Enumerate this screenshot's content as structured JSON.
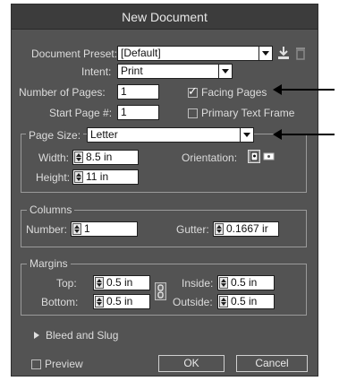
{
  "window": {
    "title": "New Document"
  },
  "document_preset": {
    "label": "Document Preset:",
    "value": "[Default]"
  },
  "intent": {
    "label": "Intent:",
    "value": "Print"
  },
  "pages": {
    "num_label": "Number of Pages:",
    "num_value": "1",
    "start_label": "Start Page #:",
    "start_value": "1"
  },
  "facing_pages": {
    "label": "Facing Pages",
    "checked": true
  },
  "primary_text_frame": {
    "label": "Primary Text Frame",
    "checked": false
  },
  "page_size": {
    "label": "Page Size:",
    "value": "Letter",
    "width_label": "Width:",
    "width_value": "8.5 in",
    "height_label": "Height:",
    "height_value": "11 in",
    "orientation_label": "Orientation:"
  },
  "columns": {
    "title": "Columns",
    "number_label": "Number:",
    "number_value": "1",
    "gutter_label": "Gutter:",
    "gutter_value": "0.1667 ir"
  },
  "margins": {
    "title": "Margins",
    "top_label": "Top:",
    "top_value": "0.5 in",
    "bottom_label": "Bottom:",
    "bottom_value": "0.5 in",
    "inside_label": "Inside:",
    "inside_value": "0.5 in",
    "outside_label": "Outside:",
    "outside_value": "0.5 in"
  },
  "bleed": {
    "label": "Bleed and Slug"
  },
  "preview": {
    "label": "Preview",
    "checked": false
  },
  "buttons": {
    "ok": "OK",
    "cancel": "Cancel"
  },
  "icons": {
    "save_preset": "save-preset-icon",
    "delete_preset": "trash-icon",
    "portrait": "portrait-orientation-icon",
    "landscape": "landscape-orientation-icon",
    "chain": "chain-link-icon",
    "expand": "triangle-right-icon"
  },
  "colors": {
    "dialog_bg": "#535353",
    "titlebar_bg": "#3c3c3c",
    "text": "#dcdcdc",
    "annotation_arrow": "#000000"
  }
}
